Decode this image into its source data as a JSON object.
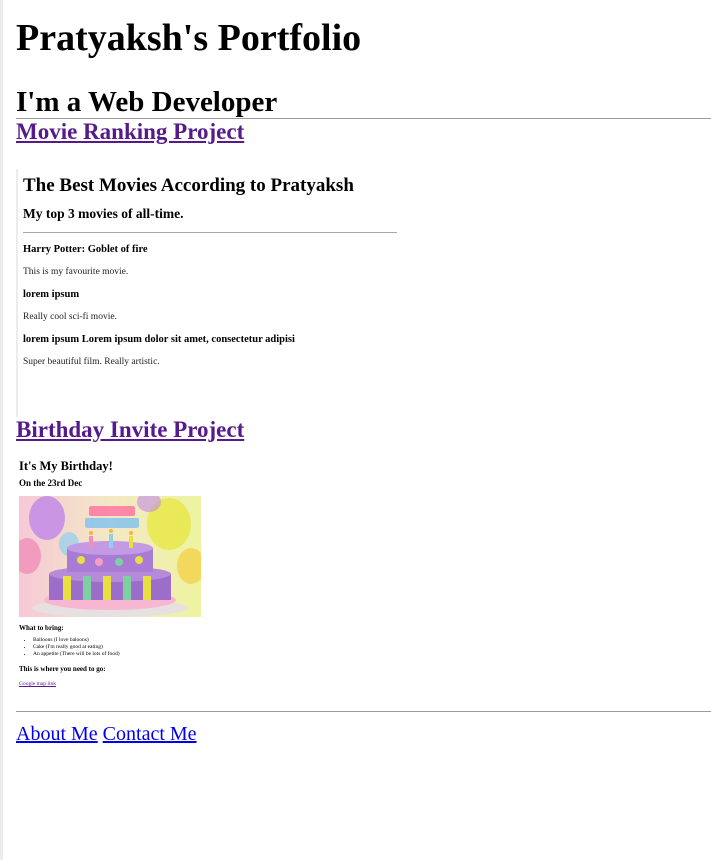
{
  "header": {
    "title": "Pratyaksh's Portfolio",
    "subtitle": "I'm a Web Developer"
  },
  "projects": {
    "movie": {
      "link_label": "Movie Ranking Project",
      "embed": {
        "title": "The Best Movies According to Pratyaksh",
        "subtitle": "My top 3 movies of all-time.",
        "movies": [
          {
            "name": "Harry Potter: Goblet of fire",
            "description": "This is my favourite movie."
          },
          {
            "name": "lorem ipsum",
            "description": "Really cool sci-fi movie."
          },
          {
            "name": "lorem ipsum Lorem ipsum dolor sit amet, consectetur adipisi",
            "description": "Super beautiful film. Really artistic."
          }
        ]
      }
    },
    "birthday": {
      "link_label": "Birthday Invite Project",
      "embed": {
        "title": "It's My Birthday!",
        "date": "On the 23rd Dec",
        "image_icon": "birthday-cake-image",
        "bring_heading": "What to bring:",
        "bring_items": [
          "Balloons (I love baloons)",
          "Cake (I'm really good at eating)",
          "An appetite (There will be lots of food)"
        ],
        "location_heading": "This is where you need to go:",
        "map_link": "Google map link"
      }
    }
  },
  "footer": {
    "about": "About Me",
    "contact": "Contact Me"
  },
  "colors": {
    "visited_link": "#551a8b",
    "link": "#0000ee"
  }
}
